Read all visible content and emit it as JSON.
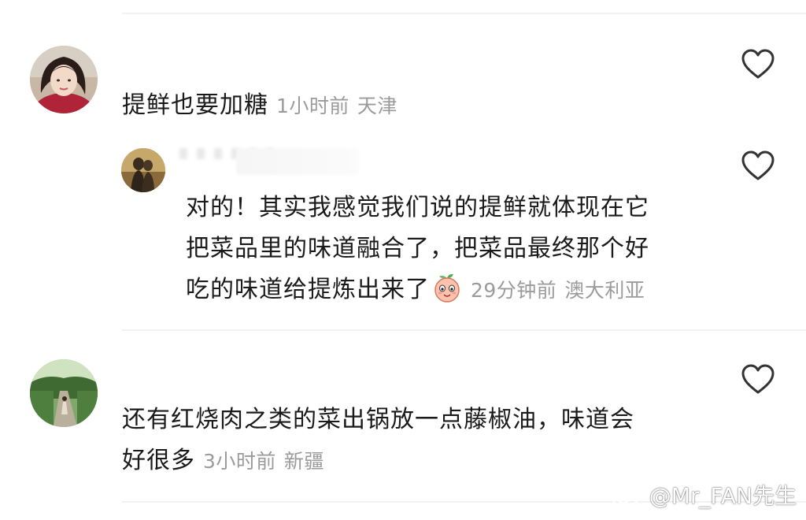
{
  "comments": [
    {
      "text": "提鲜也要加糖",
      "time": "1小时前",
      "location": "天津",
      "avatar": "woman-portrait-avatar"
    },
    {
      "text_line1": "对的！其实我感觉我们说的提鲜就体现在它",
      "text_line2": "把菜品里的味道融合了，把菜品最终那个好",
      "text_line3": "吃的味道给提炼出来了",
      "time": "29分钟前",
      "location": "澳大利亚",
      "avatar": "couple-silhouette-avatar",
      "emoji": "peach-emoji"
    },
    {
      "text_line1": "还有红烧肉之类的菜出锅放一点藤椒油，味道会",
      "text_line2": "好很多",
      "time": "3小时前",
      "location": "新疆",
      "avatar": "garden-path-avatar"
    }
  ],
  "icons": {
    "like": "heart-outline-icon",
    "watermark_logo": "weibo-logo-icon"
  },
  "watermark": {
    "text": "@Mr_FAN先生"
  },
  "colors": {
    "text": "#1a1a1a",
    "meta": "#9b9b9b",
    "divider": "#f1f1f1",
    "heart_stroke": "#333333"
  }
}
